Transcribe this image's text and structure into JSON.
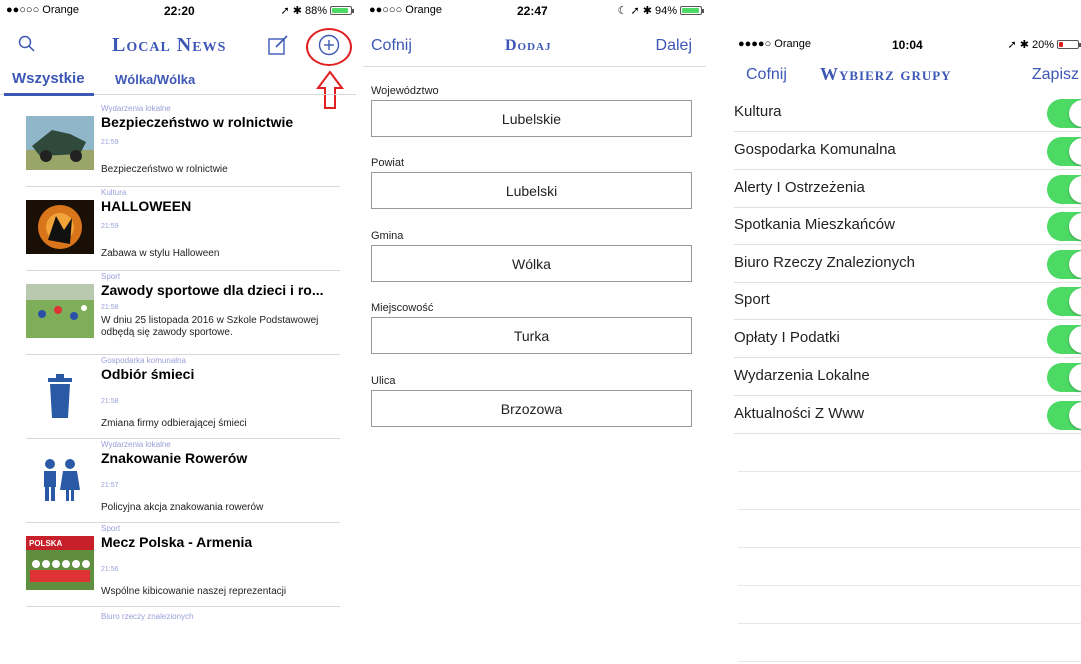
{
  "screen1": {
    "status": {
      "carrier": "●●○○○ Orange",
      "time": "22:20",
      "battery": "88%",
      "battery_level": 0.88,
      "battery_color": "#4cd964"
    },
    "nav": {
      "title": "Local News",
      "search_icon": "search-icon",
      "compose_icon": "compose-icon",
      "add_icon": "add-circle-icon"
    },
    "tabs": [
      {
        "label": "Wszystkie"
      },
      {
        "label": "Wólka/Wólka"
      }
    ],
    "news": [
      {
        "category": "Wydarzenia lokalne",
        "title": "Bezpieczeństwo w rolnictwie",
        "time": "21:59",
        "desc": "Bezpieczeństwo w rolnictwie"
      },
      {
        "category": "Kultura",
        "title": "HALLOWEEN",
        "time": "21:59",
        "desc": "Zabawa w stylu Halloween"
      },
      {
        "category": "Sport",
        "title": "Zawody sportowe dla dzieci i ro...",
        "time": "21:58",
        "desc": "W dniu 25 listopada 2016 w Szkole Podstawowej  odbędą się zawody sportowe."
      },
      {
        "category": "Gospodarka komunalna",
        "title": "Odbiór śmieci",
        "time": "21:58",
        "desc": "Zmiana firmy odbierającej śmieci"
      },
      {
        "category": "Wydarzenia lokalne",
        "title": "Znakowanie Rowerów",
        "time": "21:57",
        "desc": "Policyjna akcja znakowania rowerów"
      },
      {
        "category": "Sport",
        "title": "Mecz Polska - Armenia",
        "time": "21:56",
        "desc": "Wspólne kibicowanie naszej reprezentacji"
      }
    ],
    "next_category": "Biuro rzeczy znalezionych",
    "thumb_badge": "POLSKA",
    "accent": "#3d57b5",
    "highlight_color": "#e02020"
  },
  "screen2": {
    "status": {
      "carrier": "●●○○○ Orange",
      "time": "22:47",
      "battery": "94%",
      "battery_level": 0.94,
      "battery_color": "#4cd964"
    },
    "nav": {
      "back": "Cofnij",
      "title": "Dodaj",
      "next": "Dalej"
    },
    "fields": [
      {
        "label": "Województwo",
        "value": "Lubelskie"
      },
      {
        "label": "Powiat",
        "value": "Lubelski"
      },
      {
        "label": "Gmina",
        "value": "Wólka"
      },
      {
        "label": "Miejscowość",
        "value": "Turka"
      },
      {
        "label": "Ulica",
        "value": "Brzozowa"
      }
    ]
  },
  "screen3": {
    "status": {
      "carrier": "●●●●○ Orange",
      "time": "10:04",
      "battery": "20%",
      "battery_level": 0.2,
      "battery_color": "#e02020"
    },
    "nav": {
      "back": "Cofnij",
      "title": "Wybierz grupy",
      "save": "Zapisz"
    },
    "groups": [
      {
        "label": "Kultura",
        "on": true
      },
      {
        "label": "Gospodarka Komunalna",
        "on": true
      },
      {
        "label": "Alerty I Ostrzeżenia",
        "on": true
      },
      {
        "label": "Spotkania Mieszkańców",
        "on": true
      },
      {
        "label": "Biuro Rzeczy Znalezionych",
        "on": true
      },
      {
        "label": "Sport",
        "on": true
      },
      {
        "label": "Opłaty I Podatki",
        "on": true
      },
      {
        "label": "Wydarzenia Lokalne",
        "on": true
      },
      {
        "label": "Aktualności Z Www",
        "on": true
      }
    ],
    "toggle_color": "#4cd964"
  }
}
